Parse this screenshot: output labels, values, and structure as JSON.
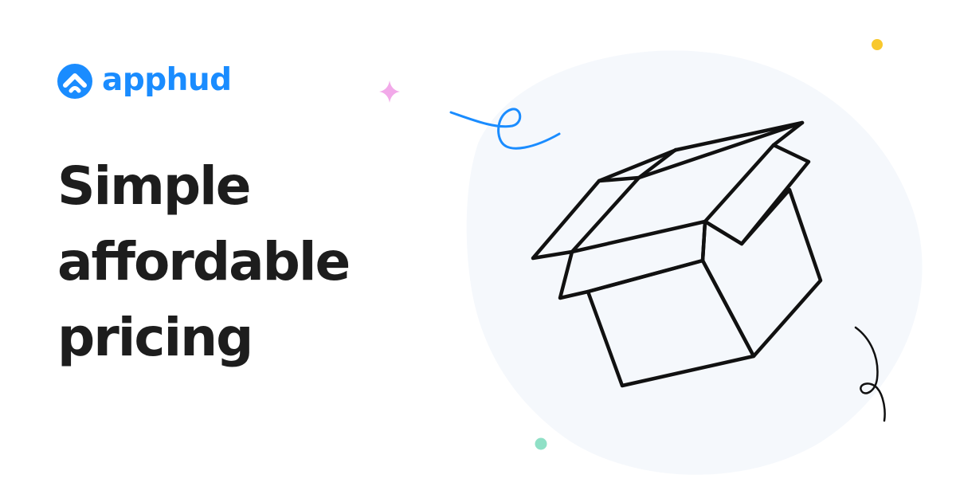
{
  "brand": {
    "name": "apphud",
    "color": "#1a8cff"
  },
  "headline": {
    "lines": [
      "Simple",
      "affordable",
      "pricing"
    ],
    "color": "#1d1d1d"
  },
  "illustration": {
    "icon": "open-box-icon",
    "blob_color": "#f5f8fc",
    "decorations": [
      "sparkle-icon",
      "blue-squiggle",
      "black-squiggle",
      "yellow-dot",
      "mint-dot"
    ],
    "colors": {
      "sparkle": "#f2a9e9",
      "blue_squiggle": "#1a8cff",
      "yellow_dot": "#f8c82d",
      "mint_dot": "#8fe0c6",
      "line": "#111111"
    }
  }
}
